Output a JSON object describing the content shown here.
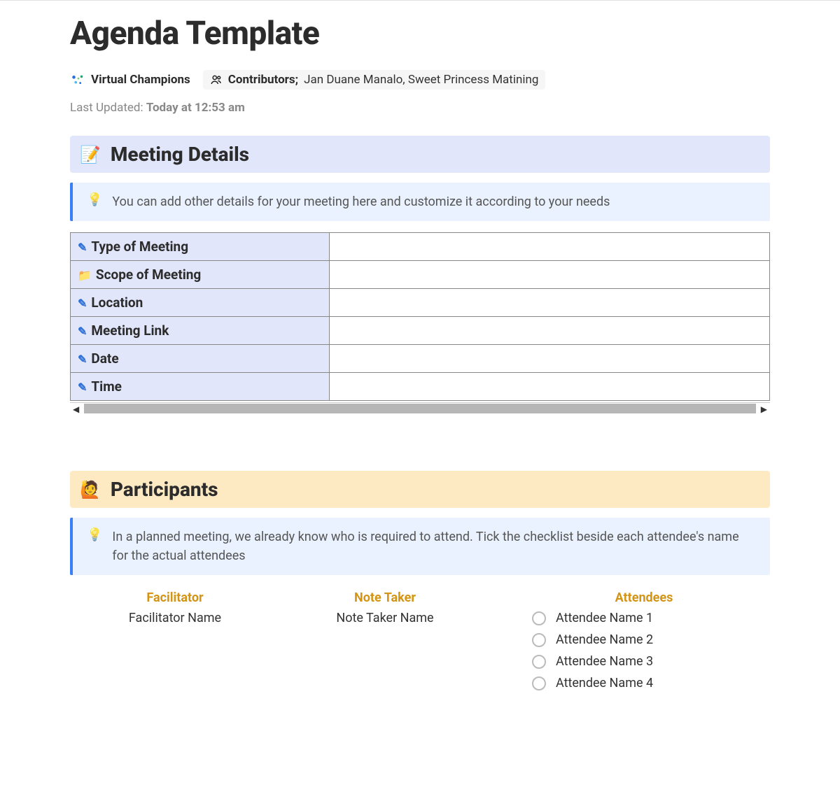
{
  "page": {
    "title": "Agenda Template",
    "organization": "Virtual Champions",
    "contributors_label": "Contributors;",
    "contributors_names": "Jan Duane Manalo, Sweet Princess Matining",
    "last_updated_label": "Last Updated:",
    "last_updated_value": "Today at 12:53 am"
  },
  "meeting_details": {
    "heading": "Meeting Details",
    "tip": "You can add other details for your meeting here and customize it according to your needs",
    "rows": [
      {
        "icon": "pencil",
        "label": "Type of Meeting",
        "value": ""
      },
      {
        "icon": "folder",
        "label": "Scope of Meeting",
        "value": ""
      },
      {
        "icon": "pencil",
        "label": "Location",
        "value": ""
      },
      {
        "icon": "pencil",
        "label": "Meeting Link",
        "value": ""
      },
      {
        "icon": "pencil",
        "label": "Date",
        "value": ""
      },
      {
        "icon": "pencil",
        "label": "Time",
        "value": ""
      }
    ]
  },
  "participants": {
    "heading": "Participants",
    "tip": "In a planned meeting, we already know who is required to attend. Tick the checklist beside each attendee's name for the actual attendees",
    "facilitator_role": "Facilitator",
    "facilitator_name": "Facilitator Name",
    "note_taker_role": "Note Taker",
    "note_taker_name": "Note Taker Name",
    "attendees_role": "Attendees",
    "attendees": [
      "Attendee Name 1",
      "Attendee Name 2",
      "Attendee Name 3",
      "Attendee Name 4"
    ]
  }
}
